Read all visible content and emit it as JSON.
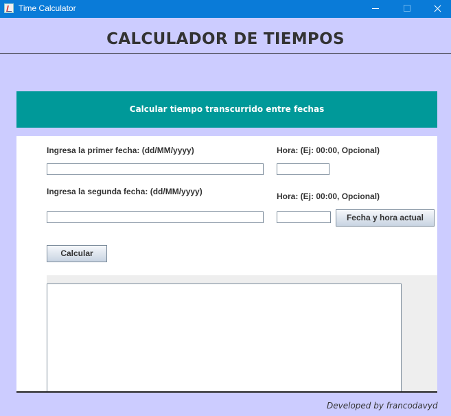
{
  "window": {
    "title": "Time Calculator"
  },
  "header": {
    "title": "CALCULADOR DE TIEMPOS"
  },
  "banner": {
    "text": "Calcular tiempo transcurrido entre fechas"
  },
  "form": {
    "first_date_label": "Ingresa la primer fecha: (dd/MM/yyyy)",
    "first_time_label": "Hora: (Ej: 00:00, Opcional)",
    "second_date_label": "Ingresa la segunda fecha: (dd/MM/yyyy)",
    "second_time_label": "Hora: (Ej: 00:00, Opcional)",
    "first_date_value": "",
    "first_time_value": "",
    "second_date_value": "",
    "second_time_value": "",
    "now_button": "Fecha y hora actual",
    "calculate_button": "Calcular"
  },
  "result": {
    "text": ""
  },
  "footer": {
    "text": "Developed by francodavyd"
  },
  "colors": {
    "background": "#ccccff",
    "titlebar": "#0a7bd8",
    "banner": "#009999"
  }
}
